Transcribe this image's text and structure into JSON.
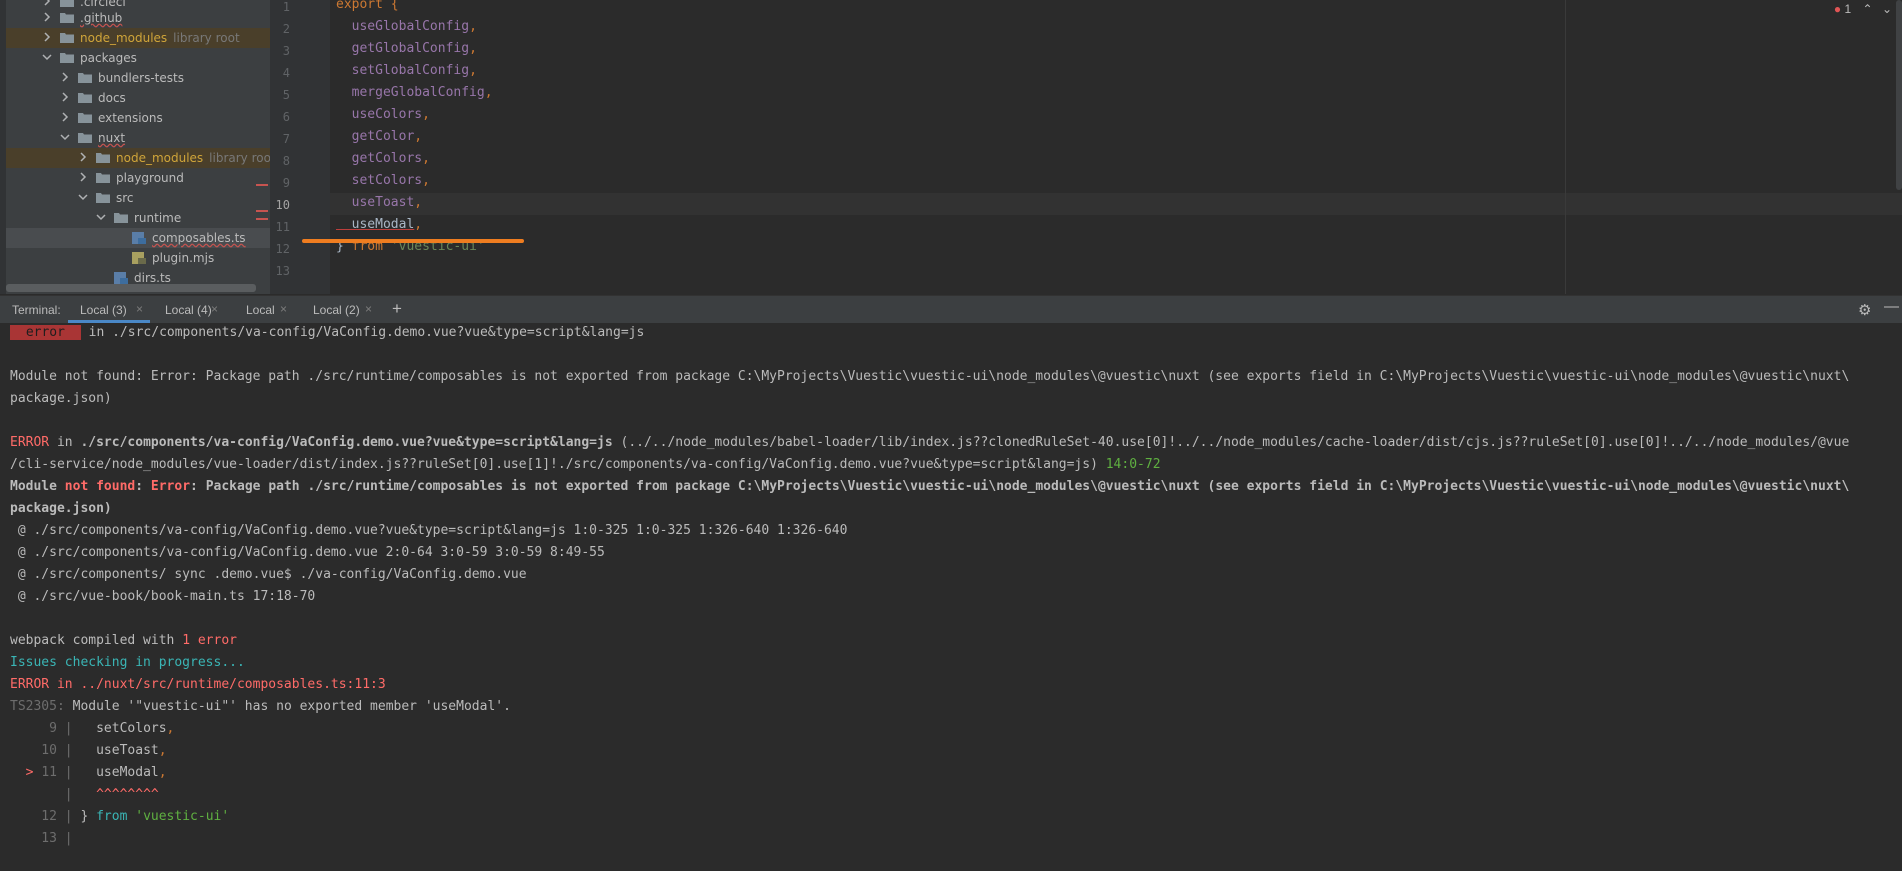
{
  "project_tree": {
    "items": [
      {
        "label": ".circleci",
        "hint": ""
      },
      {
        "label": ".github",
        "hint": ""
      },
      {
        "label": "node_modules",
        "hint": "library root"
      },
      {
        "label": "packages",
        "hint": ""
      },
      {
        "label": "bundlers-tests",
        "hint": ""
      },
      {
        "label": "docs",
        "hint": ""
      },
      {
        "label": "extensions",
        "hint": ""
      },
      {
        "label": "nuxt",
        "hint": ""
      },
      {
        "label": "node_modules",
        "hint": "library root"
      },
      {
        "label": "playground",
        "hint": ""
      },
      {
        "label": "src",
        "hint": ""
      },
      {
        "label": "runtime",
        "hint": ""
      },
      {
        "label": "composables.ts",
        "hint": ""
      },
      {
        "label": "plugin.mjs",
        "hint": ""
      },
      {
        "label": "dirs.ts",
        "hint": ""
      }
    ]
  },
  "editor": {
    "problems_count": "1",
    "lines": [
      {
        "num": "1",
        "tokens": [
          {
            "t": "export {",
            "c": "kw"
          }
        ]
      },
      {
        "num": "2",
        "tokens": [
          {
            "t": "  useGlobalConfig",
            "c": "fn"
          },
          {
            "t": ",",
            "c": "punct"
          }
        ]
      },
      {
        "num": "3",
        "tokens": [
          {
            "t": "  getGlobalConfig",
            "c": "fn"
          },
          {
            "t": ",",
            "c": "punct"
          }
        ]
      },
      {
        "num": "4",
        "tokens": [
          {
            "t": "  setGlobalConfig",
            "c": "fn"
          },
          {
            "t": ",",
            "c": "punct"
          }
        ]
      },
      {
        "num": "5",
        "tokens": [
          {
            "t": "  mergeGlobalConfig",
            "c": "fn"
          },
          {
            "t": ",",
            "c": "punct"
          }
        ]
      },
      {
        "num": "6",
        "tokens": [
          {
            "t": "  useColors",
            "c": "fn"
          },
          {
            "t": ",",
            "c": "punct"
          }
        ]
      },
      {
        "num": "7",
        "tokens": [
          {
            "t": "  getColor",
            "c": "fn"
          },
          {
            "t": ",",
            "c": "punct"
          }
        ]
      },
      {
        "num": "8",
        "tokens": [
          {
            "t": "  getColors",
            "c": "fn"
          },
          {
            "t": ",",
            "c": "punct"
          }
        ]
      },
      {
        "num": "9",
        "tokens": [
          {
            "t": "  setColors",
            "c": "fn"
          },
          {
            "t": ",",
            "c": "punct"
          }
        ]
      },
      {
        "num": "10",
        "tokens": [
          {
            "t": "  useToast",
            "c": "fn"
          },
          {
            "t": ",",
            "c": "punct"
          }
        ]
      },
      {
        "num": "11",
        "tokens": [
          {
            "t": "  useModal",
            "c": ""
          },
          {
            "t": ",",
            "c": "punct"
          }
        ]
      },
      {
        "num": "12",
        "tokens": [
          {
            "t": "} ",
            "c": ""
          },
          {
            "t": "from ",
            "c": "kw"
          },
          {
            "t": "'vuestic-ui'",
            "c": "str"
          }
        ]
      },
      {
        "num": "13",
        "tokens": []
      }
    ]
  },
  "terminal": {
    "title": "Terminal:",
    "tabs": [
      {
        "label": "Local (3)",
        "close": "×"
      },
      {
        "label": "Local (4)",
        "close": "×"
      },
      {
        "label": "Local",
        "close": "×"
      },
      {
        "label": "Local (2)",
        "close": "×"
      }
    ],
    "add": "+",
    "lines": [
      [
        {
          "t": " error ",
          "c": "badge"
        },
        {
          "t": " in ./src/components/va-config/VaConfig.demo.vue?vue&type=script&lang=js",
          "c": ""
        }
      ],
      [],
      [
        {
          "t": "Module not found: Error: Package path ./src/runtime/composables is not exported from package C:\\MyProjects\\Vuestic\\vuestic-ui\\node_modules\\@vuestic\\nuxt (see exports field in C:\\MyProjects\\Vuestic\\vuestic-ui\\node_modules\\@vuestic\\nuxt\\",
          "c": ""
        }
      ],
      [
        {
          "t": "package.json)",
          "c": ""
        }
      ],
      [],
      [
        {
          "t": "ERROR",
          "c": "red"
        },
        {
          "t": " in ",
          "c": ""
        },
        {
          "t": "./src/components/va-config/VaConfig.demo.vue?vue&type=script&lang=js",
          "c": "b"
        },
        {
          "t": " (../../node_modules/babel-loader/lib/index.js??clonedRuleSet-40.use[0]!../../node_modules/cache-loader/dist/cjs.js??ruleSet[0].use[0]!../../node_modules/@vue",
          "c": ""
        }
      ],
      [
        {
          "t": "/cli-service/node_modules/vue-loader/dist/index.js??ruleSet[0].use[1]!./src/components/va-config/VaConfig.demo.vue?vue&type=script&lang=js) ",
          "c": ""
        },
        {
          "t": "14:0-72",
          "c": "green"
        }
      ],
      [
        {
          "t": "Module ",
          "c": "b"
        },
        {
          "t": "not found",
          "c": "b red"
        },
        {
          "t": ": ",
          "c": "b"
        },
        {
          "t": "Error",
          "c": "b red"
        },
        {
          "t": ": Package path ./src/runtime/composables is not exported from package C:\\MyProjects\\Vuestic\\vuestic-ui\\node_modules\\@vuestic\\nuxt (see exports field in C:\\MyProjects\\Vuestic\\vuestic-ui\\node_modules\\@vuestic\\nuxt\\",
          "c": "b"
        }
      ],
      [
        {
          "t": "package.json)",
          "c": "b"
        }
      ],
      [
        {
          "t": " @ ./src/components/va-config/VaConfig.demo.vue?vue&type=script&lang=js 1:0-325 1:0-325 1:326-640 1:326-640",
          "c": ""
        }
      ],
      [
        {
          "t": " @ ./src/components/va-config/VaConfig.demo.vue 2:0-64 3:0-59 3:0-59 8:49-55",
          "c": ""
        }
      ],
      [
        {
          "t": " @ ./src/components/ sync .demo.vue$ ./va-config/VaConfig.demo.vue",
          "c": ""
        }
      ],
      [
        {
          "t": " @ ./src/vue-book/book-main.ts 17:18-70",
          "c": ""
        }
      ],
      [],
      [
        {
          "t": "webpack compiled with ",
          "c": ""
        },
        {
          "t": "1 error",
          "c": "red"
        }
      ],
      [
        {
          "t": "Issues checking in progress...",
          "c": "cyan"
        }
      ],
      [
        {
          "t": "ERROR in ../nuxt/src/runtime/composables.ts:11:3",
          "c": "red"
        }
      ],
      [
        {
          "t": "TS2305: ",
          "c": "gray"
        },
        {
          "t": "Module '\"vuestic-ui\"' has no exported member 'useModal'.",
          "c": ""
        }
      ],
      [
        {
          "t": "     9 | ",
          "c": "gray"
        },
        {
          "t": "  setColors",
          "c": ""
        },
        {
          "t": ",",
          "c": "ylw"
        }
      ],
      [
        {
          "t": "    10 | ",
          "c": "gray"
        },
        {
          "t": "  useToast",
          "c": ""
        },
        {
          "t": ",",
          "c": "ylw"
        }
      ],
      [
        {
          "t": "  > ",
          "c": "red"
        },
        {
          "t": "11 | ",
          "c": "gray"
        },
        {
          "t": "  useModal",
          "c": ""
        },
        {
          "t": ",",
          "c": "ylw"
        }
      ],
      [
        {
          "t": "       | ",
          "c": "gray"
        },
        {
          "t": "  ^^^^^^^^",
          "c": "red"
        }
      ],
      [
        {
          "t": "    12 | ",
          "c": "gray"
        },
        {
          "t": "} ",
          "c": ""
        },
        {
          "t": "from",
          "c": "cyan"
        },
        {
          "t": " 'vuestic-ui'",
          "c": "green"
        }
      ],
      [
        {
          "t": "    13 | ",
          "c": "gray"
        }
      ]
    ]
  }
}
